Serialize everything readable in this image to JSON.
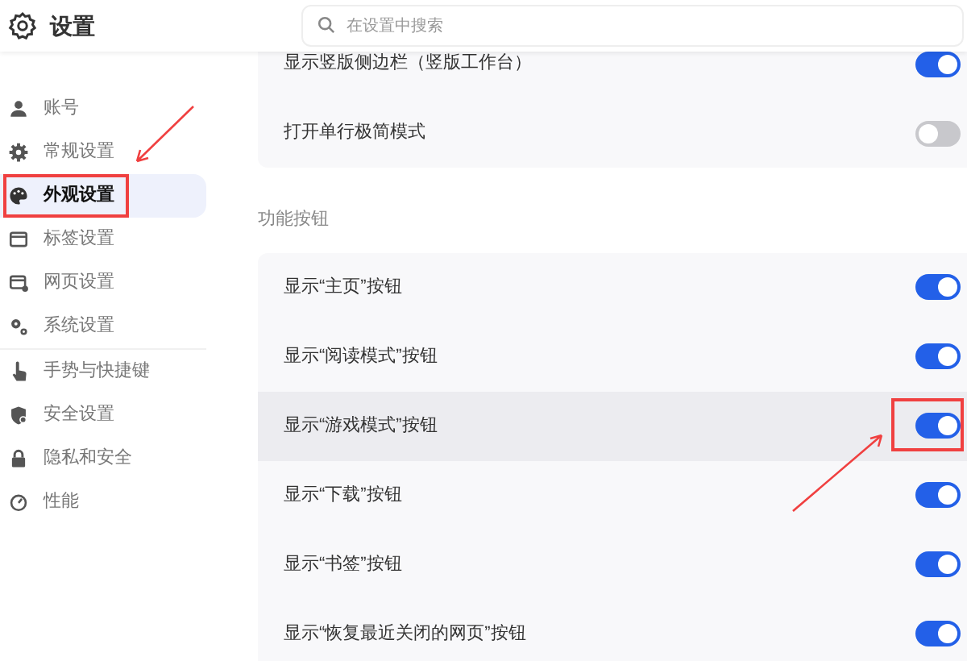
{
  "window": {
    "title": "设置"
  },
  "search": {
    "placeholder": "在设置中搜索"
  },
  "sidebar": {
    "items": [
      {
        "label": "账号",
        "selected": false,
        "annotated": false
      },
      {
        "label": "常规设置",
        "selected": false,
        "annotated": false
      },
      {
        "label": "外观设置",
        "selected": true,
        "annotated": true
      },
      {
        "label": "标签设置",
        "selected": false,
        "annotated": false
      },
      {
        "label": "网页设置",
        "selected": false,
        "annotated": false
      },
      {
        "label": "系统设置",
        "selected": false,
        "annotated": false
      },
      {
        "label": "手势与快捷键",
        "selected": false,
        "annotated": false
      },
      {
        "label": "安全设置",
        "selected": false,
        "annotated": false
      },
      {
        "label": "隐私和安全",
        "selected": false,
        "annotated": false
      },
      {
        "label": "性能",
        "selected": false,
        "annotated": false
      }
    ]
  },
  "sections": [
    {
      "rows": [
        {
          "label": "显示竖版侧边栏（竖版工作台）",
          "on": true,
          "selected": false,
          "annotated": false
        },
        {
          "label": "打开单行极简模式",
          "on": false,
          "selected": false,
          "annotated": false
        }
      ]
    },
    {
      "title": "功能按钮",
      "rows": [
        {
          "label": "显示“主页”按钮",
          "on": true,
          "selected": false,
          "annotated": false
        },
        {
          "label": "显示“阅读模式”按钮",
          "on": true,
          "selected": false,
          "annotated": false
        },
        {
          "label": "显示“游戏模式”按钮",
          "on": true,
          "selected": true,
          "annotated": true
        },
        {
          "label": "显示“下载”按钮",
          "on": true,
          "selected": false,
          "annotated": false
        },
        {
          "label": "显示“书签”按钮",
          "on": true,
          "selected": false,
          "annotated": false
        },
        {
          "label": "显示“恢复最近关闭的网页”按钮",
          "on": true,
          "selected": false,
          "annotated": false
        }
      ]
    }
  ]
}
